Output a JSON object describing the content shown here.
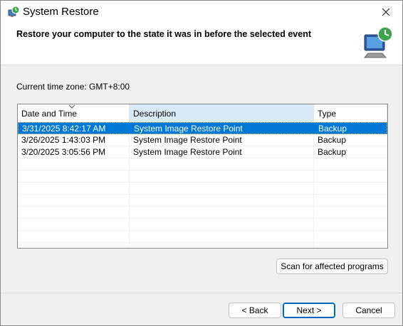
{
  "window": {
    "title": "System Restore"
  },
  "header": {
    "text": "Restore your computer to the state it was in before the selected event"
  },
  "timezone": "Current time zone: GMT+8:00",
  "table": {
    "columns": [
      "Date and Time",
      "Description",
      "Type"
    ],
    "rows": [
      {
        "date": "3/31/2025 8:42:17 AM",
        "description": "System Image Restore Point",
        "type": "Backup"
      },
      {
        "date": "3/26/2025 1:43:03 PM",
        "description": "System Image Restore Point",
        "type": "Backup"
      },
      {
        "date": "3/20/2025 3:05:56 PM",
        "description": "System Image Restore Point",
        "type": "Backup"
      }
    ]
  },
  "buttons": {
    "scan": "Scan for affected programs",
    "back": "< Back",
    "next": "Next >",
    "cancel": "Cancel"
  },
  "icons": {
    "title": "system-restore-icon",
    "header": "restore-computer-icon",
    "close": "close-icon"
  },
  "colors": {
    "selection": "#0078d7",
    "primary_border": "#0067c0"
  }
}
